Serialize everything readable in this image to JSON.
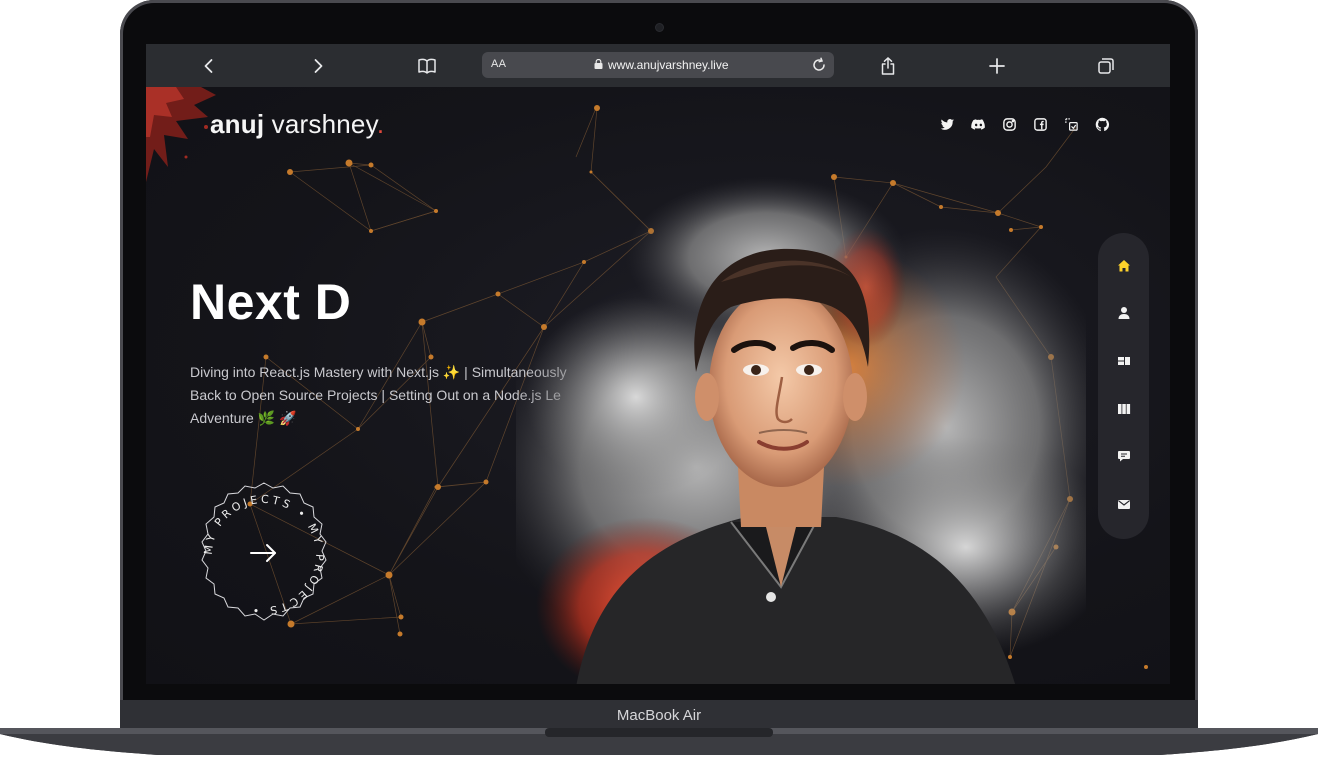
{
  "device": {
    "model_label": "MacBook Air"
  },
  "browser": {
    "reader_label": "AA",
    "url": "www.anujvarshney.live",
    "buttons": [
      "back-icon",
      "forward-icon",
      "bookmarks-icon",
      "share-icon",
      "new-tab-icon",
      "tabs-icon"
    ]
  },
  "site": {
    "brand_first": "anuj",
    "brand_last": " varshney",
    "brand_dot": ".",
    "socials": [
      "twitter-icon",
      "discord-icon",
      "instagram-icon",
      "facebook-icon",
      "wakatime-icon",
      "github-icon"
    ],
    "hero_title": "Next D",
    "hero_desc": "Diving into React.js Mastery with Next.js ✨ | Simultaneously Back to Open Source Projects | Setting Out on a Node.js Le Adventure 🌿 🚀",
    "badge_text": "MY PROJECTS • MY PROJECTS •",
    "nav": [
      "home-icon",
      "user-icon",
      "services-icon",
      "portfolio-icon",
      "chat-icon",
      "mail-icon"
    ],
    "active_nav": "home-icon"
  },
  "colors": {
    "accent_yellow": "#ffd32b",
    "brand_dot": "#e0493d",
    "network_node": "#c57a2b",
    "page_bg": "#141419"
  }
}
